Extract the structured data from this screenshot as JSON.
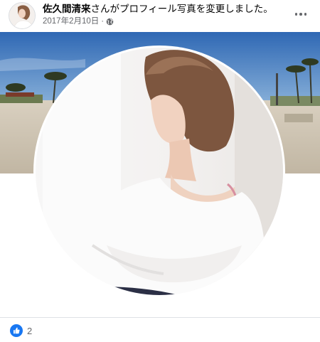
{
  "post": {
    "author": "佐久間清来",
    "action": "さんがプロフィール写真を変更しました。",
    "date": "2017年2月10日",
    "separator": "·",
    "privacy_icon": "globe-icon",
    "more_icon": "more-options-icon"
  },
  "reactions": {
    "icon": "like-icon",
    "count": "2"
  },
  "colors": {
    "accent": "#1877f2",
    "secondary_text": "#65676b",
    "sky": "#3f76b8",
    "sand": "#cfc6b6"
  }
}
